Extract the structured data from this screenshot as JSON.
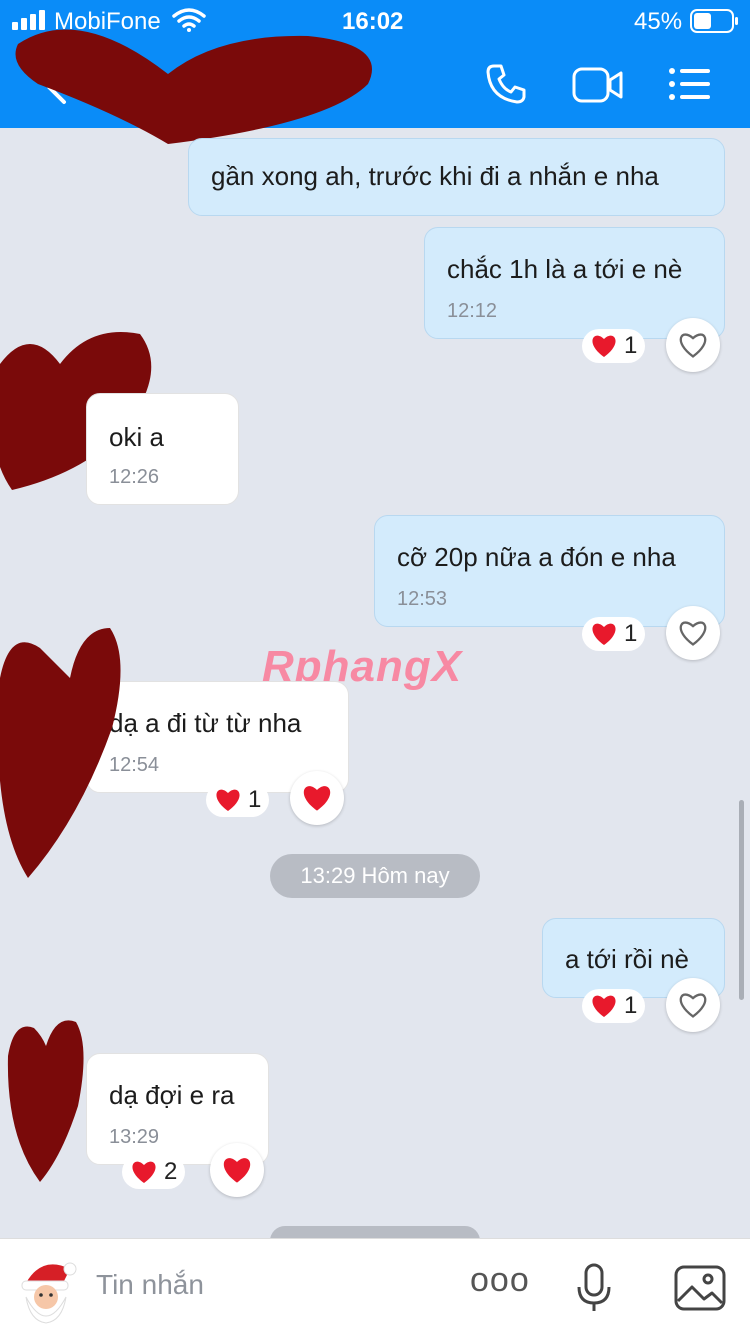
{
  "status_bar": {
    "carrier": "MobiFone",
    "time": "16:02",
    "battery": "45%"
  },
  "header": {
    "icons": [
      "phone-icon",
      "video-call-icon",
      "menu-list-icon"
    ]
  },
  "messages": [
    {
      "side": "me",
      "text": "gần xong ah, trước khi đi a nhắn e nha",
      "time": ""
    },
    {
      "side": "me",
      "text": "chắc 1h là a tới e nè",
      "time": "12:12",
      "reaction_count": "1"
    },
    {
      "side": "them",
      "text": "oki a",
      "time": "12:26"
    },
    {
      "side": "me",
      "text": "cỡ 20p nữa a đón e nha",
      "time": "12:53",
      "reaction_count": "1"
    },
    {
      "side": "them",
      "text": "dạ a đi từ từ nha",
      "time": "12:54",
      "reaction_count": "1"
    },
    {
      "side": "me",
      "text": "a tới rồi nè",
      "time": "",
      "reaction_count": "1"
    },
    {
      "side": "them",
      "text": "dạ đợi e ra",
      "time": "13:29",
      "reaction_count": "2"
    }
  ],
  "date_separator": "13:29 Hôm nay",
  "watermark": "RphangX",
  "composer": {
    "placeholder": "Tin nhắn",
    "more_label": "ooo"
  },
  "colors": {
    "header": "#0a8cf8",
    "bubble_me": "#d3ebfc",
    "bubble_them": "#ffffff",
    "heart": "#e8192c",
    "redaction": "#7a0a0a"
  }
}
